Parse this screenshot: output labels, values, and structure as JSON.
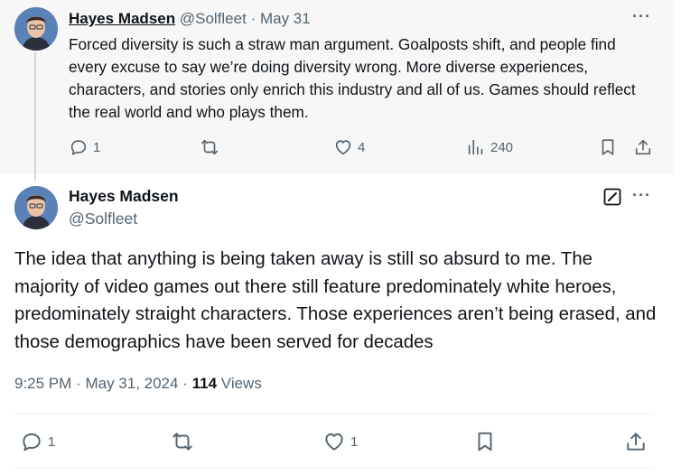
{
  "parent_tweet": {
    "author_name": "Hayes Madsen",
    "handle": "@Solfleet",
    "separator": "·",
    "date": "May 31",
    "more": "···",
    "text": "Forced diversity is such a straw man argument. Goalposts shift, and people find every excuse to say we’re doing diversity wrong. More diverse experiences, characters, and stories only enrich this industry and all of us. Games should reflect the real world and who plays them.",
    "replies": "1",
    "likes": "4",
    "views": "240"
  },
  "main_tweet": {
    "author_name": "Hayes Madsen",
    "handle": "@Solfleet",
    "more": "···",
    "text": "The idea that anything is being taken away is still so absurd to me. The majority of video games out there still feature predominately white heroes, predominately straight characters. Those experiences aren’t being erased, and those demographics have been served for decades",
    "time": "9:25 PM",
    "separator": "·",
    "date": "May 31, 2024",
    "views_count": "114",
    "views_label": "Views",
    "replies": "1",
    "likes": "1"
  },
  "icons": [
    "reply-icon",
    "retweet-icon",
    "like-icon",
    "views-icon",
    "bookmark-icon",
    "share-icon",
    "edit-icon",
    "more-icon"
  ],
  "colors": {
    "muted": "#536471",
    "text": "#0f1419",
    "divider": "#eff3f4",
    "parent_bg": "#f7f7f7"
  }
}
